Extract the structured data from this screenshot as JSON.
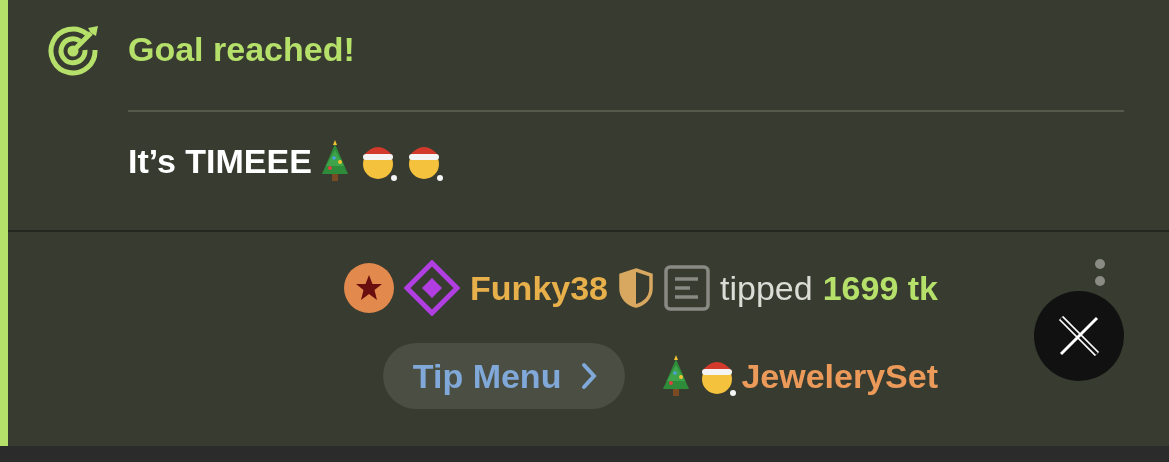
{
  "goal": {
    "title": "Goal reached!",
    "message": "It’s TIMEEE"
  },
  "tip": {
    "username": "Funky38",
    "action": "tipped",
    "amount": "1699 tk",
    "menu_button": "Tip Menu",
    "item": "JewelerySet"
  }
}
